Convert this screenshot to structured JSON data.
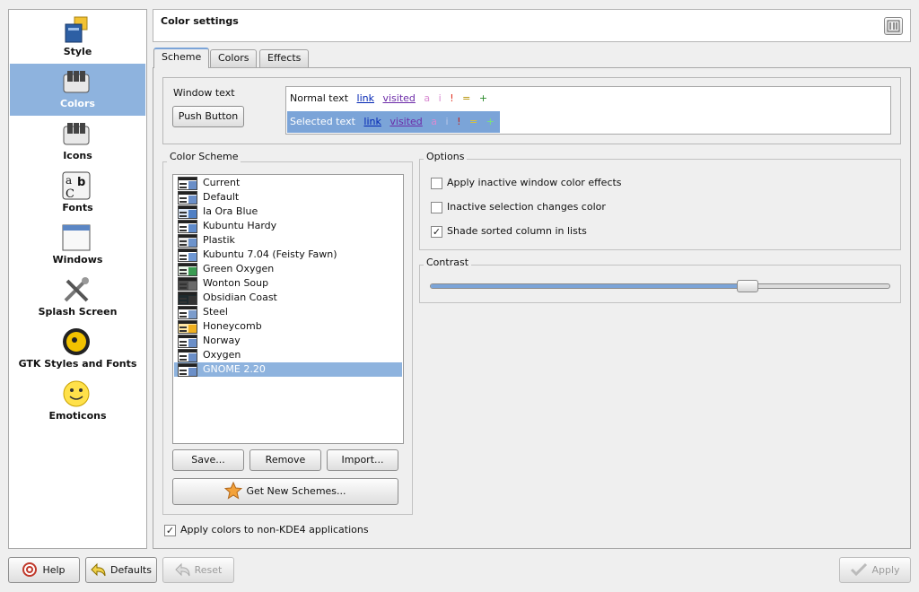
{
  "sidebar": {
    "items": [
      {
        "label": "Style",
        "icon": "style-icon"
      },
      {
        "label": "Colors",
        "icon": "colors-icon",
        "selected": true
      },
      {
        "label": "Icons",
        "icon": "icons-icon"
      },
      {
        "label": "Fonts",
        "icon": "fonts-icon"
      },
      {
        "label": "Windows",
        "icon": "windows-icon"
      },
      {
        "label": "Splash Screen",
        "icon": "splash-screen-icon"
      },
      {
        "label": "GTK Styles and Fonts",
        "icon": "gtk-icon"
      },
      {
        "label": "Emoticons",
        "icon": "emoticons-icon"
      }
    ]
  },
  "header": {
    "title": "Color settings"
  },
  "tabs": [
    "Scheme",
    "Colors",
    "Effects"
  ],
  "preview": {
    "window_text_label": "Window text",
    "push_button": "Push Button",
    "normal_text": "Normal text",
    "selected_text": "Selected text",
    "link": "link",
    "visited": "visited",
    "chars": [
      "a",
      "i",
      "!",
      "=",
      "+"
    ]
  },
  "color_scheme": {
    "title": "Color Scheme",
    "schemes": [
      "Current",
      "Default",
      "Ia Ora Blue",
      "Kubuntu Hardy",
      "Plastik",
      "Kubuntu 7.04 (Feisty Fawn)",
      "Green Oxygen",
      "Wonton Soup",
      "Obsidian Coast",
      "Steel",
      "Honeycomb",
      "Norway",
      "Oxygen",
      "GNOME 2.20"
    ],
    "selected": "GNOME 2.20",
    "save_label": "Save...",
    "remove_label": "Remove",
    "import_label": "Import...",
    "get_new_label": "Get New Schemes..."
  },
  "options": {
    "title": "Options",
    "items": [
      {
        "label": "Apply inactive window color effects",
        "checked": false
      },
      {
        "label": "Inactive selection changes color",
        "checked": false
      },
      {
        "label": "Shade sorted column in lists",
        "checked": true
      }
    ]
  },
  "contrast": {
    "title": "Contrast",
    "value_fraction": 0.69
  },
  "apply_non_kde": {
    "label": "Apply colors to non-KDE4 applications",
    "checked": true
  },
  "footer": {
    "help_label": "Help",
    "defaults_label": "Defaults",
    "reset_label": "Reset",
    "apply_label": "Apply"
  },
  "colors": {
    "selection": "#8eb3de",
    "link": "#0024b3",
    "visited": "#6c2ba8"
  }
}
